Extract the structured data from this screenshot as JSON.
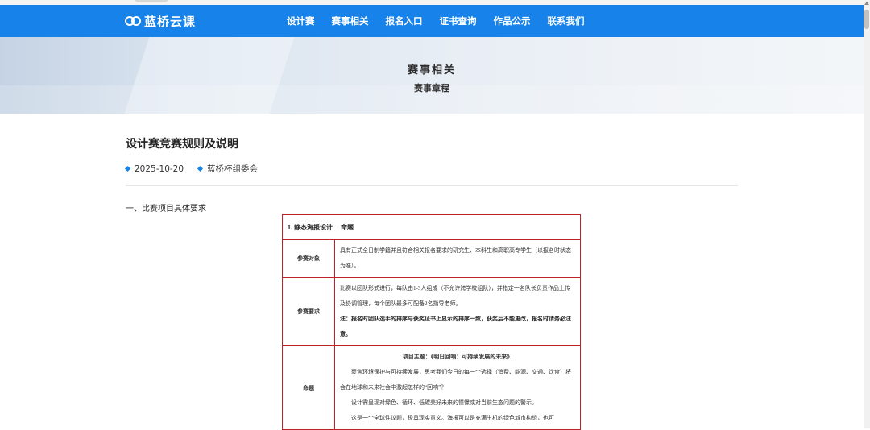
{
  "brand": {
    "name": "蓝桥云课"
  },
  "nav": {
    "items": [
      "设计赛",
      "赛事相关",
      "报名入口",
      "证书查询",
      "作品公示",
      "联系我们"
    ]
  },
  "banner": {
    "title": "赛事相关",
    "subtitle": "赛事章程"
  },
  "article": {
    "title": "设计赛竞赛规则及说明",
    "date": "2025-10-20",
    "author": "蓝桥杯组委会",
    "section_heading": "一、比赛项目具体要求"
  },
  "table": {
    "header": "1. 静态海报设计　 命题",
    "rows": {
      "participants": {
        "label": "参赛对象",
        "text": "具有正式全日制学籍并且符合相关报名要求的研究生、本科生和高职高专学生（以报名时状态为准）。"
      },
      "requirements": {
        "label": "参赛要求",
        "text1": "比赛以团队形式进行，每队由1-3人组成（不允许跨学校组队），并指定一名队长负责作品上传及协调管理，每个团队最多可配备2名指导老师。",
        "text2": "注：报名时团队选手的排序与获奖证书上显示的排序一致，获奖后不能更改，报名时请务必注意。"
      },
      "topic": {
        "label": "命题",
        "theme": "项目主题：《明日回响：可持续发展的未来》",
        "p1": "聚焦环境保护与可持续发展，思考我们今日的每一个选择（消费、能源、交通、饮食）将会在地球和未来社会中激起怎样的“回响”？",
        "p2": "设计需呈现对绿色、循环、低碳美好未来的憧憬或对当前生态问题的警示。",
        "p3": "这是一个全球性议题，极具现实意义。海报可以是充满生机的绿色城市构想，也可"
      }
    }
  },
  "colors": {
    "nav": "#1682ea",
    "table_border": "#c0202a"
  }
}
